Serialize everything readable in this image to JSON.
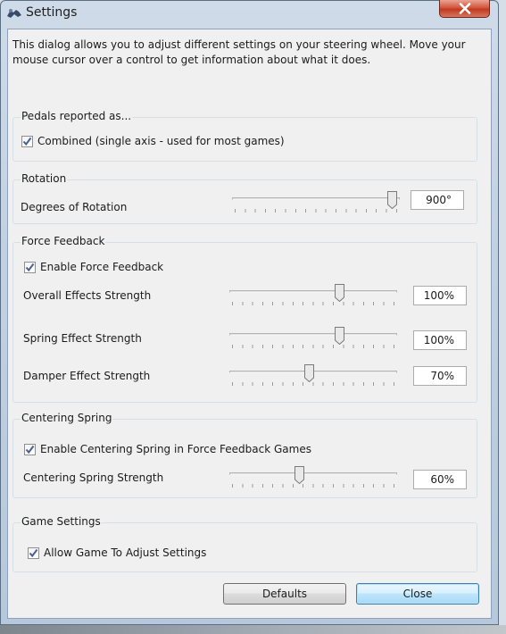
{
  "window": {
    "title": "Settings"
  },
  "intro": "This dialog allows you to adjust different settings on your steering wheel.  Move your mouse cursor over a control to get information about what it does.",
  "pedals": {
    "title": "Pedals reported as...",
    "combined": {
      "label": "Combined (single axis - used for most games)",
      "checked": true
    }
  },
  "rotation": {
    "title": "Rotation",
    "degrees_label": "Degrees of Rotation",
    "degrees_value": "900°",
    "slider_fraction": 0.97
  },
  "force_feedback": {
    "title": "Force Feedback",
    "enable": {
      "label": "Enable Force Feedback",
      "checked": true
    },
    "overall": {
      "label": "Overall Effects Strength",
      "value": "100%",
      "slider_fraction": 0.66
    },
    "spring": {
      "label": "Spring Effect Strength",
      "value": "100%",
      "slider_fraction": 0.66
    },
    "damper": {
      "label": "Damper Effect Strength",
      "value": "70%",
      "slider_fraction": 0.47
    }
  },
  "centering": {
    "title": "Centering Spring",
    "enable": {
      "label": "Enable Centering Spring in Force Feedback Games",
      "checked": true
    },
    "strength": {
      "label": "Centering Spring Strength",
      "value": "60%",
      "slider_fraction": 0.41
    }
  },
  "game_settings": {
    "title": "Game Settings",
    "allow": {
      "label": "Allow Game To Adjust Settings",
      "checked": true
    }
  },
  "buttons": {
    "defaults": "Defaults",
    "close": "Close"
  },
  "colors": {
    "close_button": "#c23a1f",
    "default_button_border": "#3c7fb1",
    "checkmark": "#4a5f97"
  }
}
